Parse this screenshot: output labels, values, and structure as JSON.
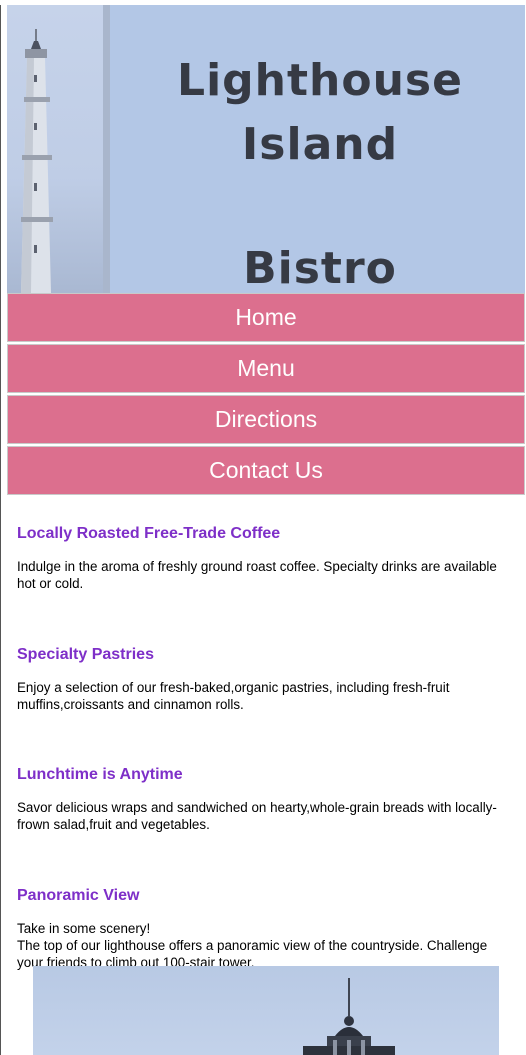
{
  "header": {
    "title_line1": "Lighthouse Island",
    "title_line2": "Bistro",
    "image_alt": "lighthouse tower"
  },
  "nav": {
    "items": [
      {
        "label": "Home"
      },
      {
        "label": "Menu"
      },
      {
        "label": "Directions"
      },
      {
        "label": "Contact Us"
      }
    ]
  },
  "sections": [
    {
      "heading": "Locally Roasted Free-Trade Coffee",
      "text": "Indulge in the aroma of freshly ground roast coffee. Specialty drinks are available hot or cold."
    },
    {
      "heading": "Specialty Pastries",
      "text": "Enjoy a selection of our fresh-baked,organic pastries, including fresh-fruit muffins,croissants and cinnamon rolls."
    },
    {
      "heading": "Lunchtime is Anytime",
      "text": "Savor delicious wraps and sandwiched on hearty,whole-grain breads with locally-frown salad,fruit and vegetables."
    },
    {
      "heading": "Panoramic View",
      "text_line1": "Take in some scenery!",
      "text_line2": "The top of our lighthouse offers a panoramic view of the countryside. Challenge your friends to climb out 100-stair tower."
    }
  ],
  "colors": {
    "header_bg": "#b3c7e6",
    "title": "#363a44",
    "nav_bg": "#dc6f8e",
    "nav_text": "#ffffff",
    "heading": "#7e2fc8"
  }
}
